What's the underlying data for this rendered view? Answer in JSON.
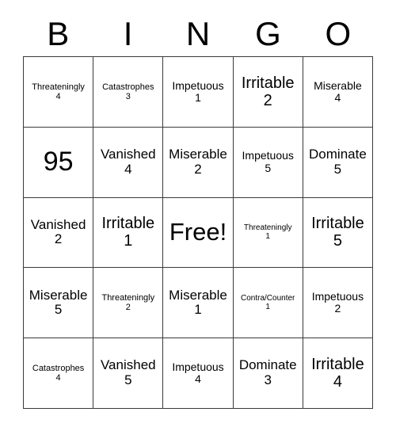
{
  "header": {
    "letters": [
      "B",
      "I",
      "N",
      "G",
      "O"
    ]
  },
  "colors": {
    "grid_line": "#3a3a3a",
    "text": "#000000",
    "background": "#ffffff"
  },
  "grid": {
    "columns": 5,
    "rows": 5,
    "cells": [
      [
        {
          "word": "Threateningly",
          "number": "4",
          "size": "sm"
        },
        {
          "word": "Catastrophes",
          "number": "3",
          "size": "sm"
        },
        {
          "word": "Impetuous",
          "number": "1",
          "size": "md"
        },
        {
          "word": "Irritable",
          "number": "2",
          "size": "xl"
        },
        {
          "word": "Miserable",
          "number": "4",
          "size": "md"
        }
      ],
      [
        {
          "word": "",
          "number": "95",
          "size": "bignum"
        },
        {
          "word": "Vanished",
          "number": "4",
          "size": "lg"
        },
        {
          "word": "Miserable",
          "number": "2",
          "size": "lg"
        },
        {
          "word": "Impetuous",
          "number": "5",
          "size": "md"
        },
        {
          "word": "Dominate",
          "number": "5",
          "size": "lg"
        }
      ],
      [
        {
          "word": "Vanished",
          "number": "2",
          "size": "lg"
        },
        {
          "word": "Irritable",
          "number": "1",
          "size": "xl"
        },
        {
          "word": "Free!",
          "number": "",
          "size": "free"
        },
        {
          "word": "Threateningly",
          "number": "1",
          "size": "xs"
        },
        {
          "word": "Irritable",
          "number": "5",
          "size": "xl"
        }
      ],
      [
        {
          "word": "Miserable",
          "number": "5",
          "size": "lg"
        },
        {
          "word": "Threateningly",
          "number": "2",
          "size": "sm"
        },
        {
          "word": "Miserable",
          "number": "1",
          "size": "lg"
        },
        {
          "word": "Contra/Counter",
          "number": "1",
          "size": "xs"
        },
        {
          "word": "Impetuous",
          "number": "2",
          "size": "md"
        }
      ],
      [
        {
          "word": "Catastrophes",
          "number": "4",
          "size": "sm"
        },
        {
          "word": "Vanished",
          "number": "5",
          "size": "lg"
        },
        {
          "word": "Impetuous",
          "number": "4",
          "size": "md"
        },
        {
          "word": "Dominate",
          "number": "3",
          "size": "lg"
        },
        {
          "word": "Irritable",
          "number": "4",
          "size": "xl"
        }
      ]
    ]
  }
}
